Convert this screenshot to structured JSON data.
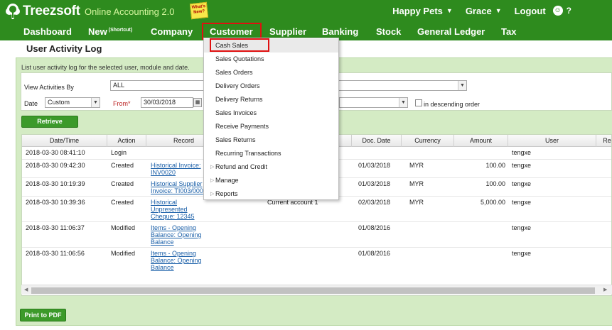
{
  "header": {
    "logo_text": "Treezsoft",
    "tagline": "Online Accounting 2.0",
    "whats_new": "What's New?",
    "company": "Happy Pets",
    "user": "Grace",
    "logout": "Logout",
    "help": "?"
  },
  "nav": {
    "items": [
      "Dashboard",
      "New",
      "Company",
      "Customer",
      "Supplier",
      "Banking",
      "Stock",
      "General Ledger",
      "Tax"
    ],
    "new_sup": "(Shortcut)",
    "active": "Customer"
  },
  "page": {
    "title": "User Activity Log",
    "description": "List user activity log for the selected user, module and date."
  },
  "filters": {
    "view_by_label": "View Activities By",
    "view_by_value": "ALL",
    "date_label": "Date",
    "date_value": "Custom",
    "from_label": "From*",
    "from_value": "30/03/2018",
    "descending_label": "in descending order",
    "retrieve_label": "Retrieve"
  },
  "table": {
    "columns": [
      "Date/Time",
      "Action",
      "Record",
      "",
      "Doc. Date",
      "Currency",
      "Amount",
      "User",
      "Re"
    ],
    "rows": [
      {
        "datetime": "2018-03-30 08:41:10",
        "action": "Login",
        "record": "",
        "desc": "",
        "doc_date": "",
        "currency": "",
        "amount": "",
        "user": "tengxe"
      },
      {
        "datetime": "2018-03-30 09:42:30",
        "action": "Created",
        "record": "Historical Invoice: INV0020",
        "desc": "",
        "doc_date": "01/03/2018",
        "currency": "MYR",
        "amount": "100.00",
        "user": "tengxe"
      },
      {
        "datetime": "2018-03-30 10:19:39",
        "action": "Created",
        "record": "Historical Supplier Invoice: TI003/000",
        "desc": "",
        "doc_date": "01/03/2018",
        "currency": "MYR",
        "amount": "100.00",
        "user": "tengxe"
      },
      {
        "datetime": "2018-03-30 10:39:36",
        "action": "Created",
        "record": "Historical Unpresented Cheque: 12345",
        "desc": "Current account 1",
        "doc_date": "02/03/2018",
        "currency": "MYR",
        "amount": "5,000.00",
        "user": "tengxe"
      },
      {
        "datetime": "2018-03-30 11:06:37",
        "action": "Modified",
        "record": "Items - Opening Balance: Opening Balance",
        "desc": "",
        "doc_date": "01/08/2016",
        "currency": "",
        "amount": "",
        "user": "tengxe"
      },
      {
        "datetime": "2018-03-30 11:06:56",
        "action": "Modified",
        "record": "Items - Opening Balance: Opening Balance",
        "desc": "",
        "doc_date": "01/08/2016",
        "currency": "",
        "amount": "",
        "user": "tengxe"
      }
    ]
  },
  "footer": {
    "print_pdf": "Print to PDF"
  },
  "dropdown": {
    "items": [
      {
        "label": "Cash Sales",
        "submenu": false
      },
      {
        "label": "Sales Quotations",
        "submenu": false
      },
      {
        "label": "Sales Orders",
        "submenu": false
      },
      {
        "label": "Delivery Orders",
        "submenu": false
      },
      {
        "label": "Delivery Returns",
        "submenu": false
      },
      {
        "label": "Sales Invoices",
        "submenu": false
      },
      {
        "label": "Receive Payments",
        "submenu": false
      },
      {
        "label": "Sales Returns",
        "submenu": false
      },
      {
        "label": "Recurring Transactions",
        "submenu": false
      },
      {
        "label": "Refund and Credit",
        "submenu": true
      },
      {
        "label": "Manage",
        "submenu": true
      },
      {
        "label": "Reports",
        "submenu": true
      }
    ]
  },
  "colors": {
    "brand_green": "#2e8b1e",
    "panel_green": "#d4ebc4",
    "highlight_red": "#e01010",
    "link_blue": "#1a5fa8"
  }
}
